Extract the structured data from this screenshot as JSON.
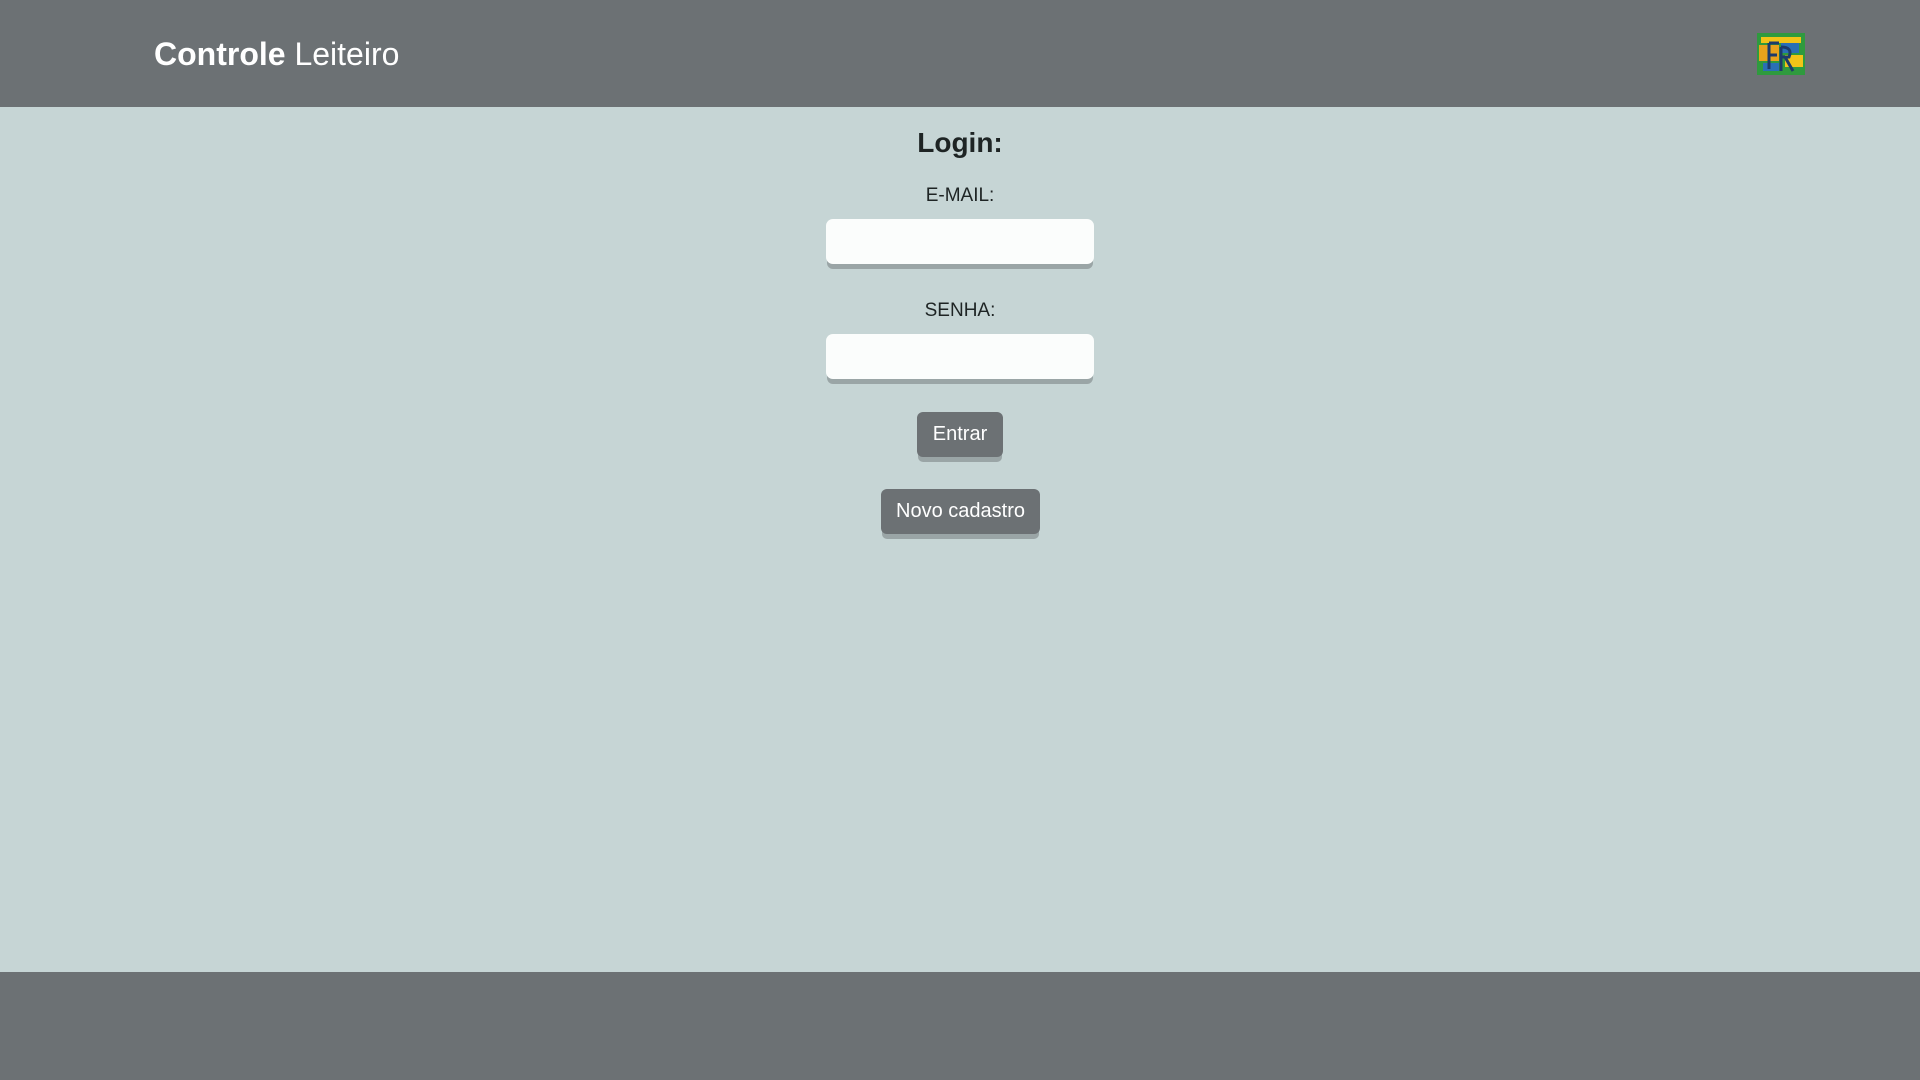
{
  "header": {
    "brand_bold": "Controle",
    "brand_light": " Leiteiro",
    "logo_icon": "app-logo-icon",
    "background_color": "#6c7174"
  },
  "login": {
    "title": "Login:",
    "email_label": "E-MAIL:",
    "email_value": "",
    "password_label": "SENHA:",
    "password_value": "",
    "submit_label": "Entrar",
    "register_label": "Novo cadastro"
  },
  "colors": {
    "page_background": "#c6d5d5",
    "bar_background": "#6c7174",
    "button_background": "#6c7174",
    "input_background": "#fbfdfc"
  }
}
